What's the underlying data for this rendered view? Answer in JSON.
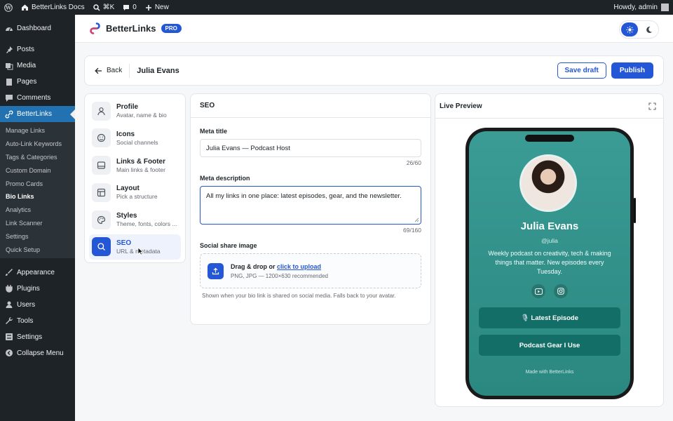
{
  "adminbar": {
    "site_name": "BetterLinks Docs",
    "shortcut": "⌘K",
    "comments_count": "0",
    "new_label": "New",
    "howdy": "Howdy, admin"
  },
  "sidebar": {
    "dashboard": "Dashboard",
    "posts": "Posts",
    "media": "Media",
    "pages": "Pages",
    "comments": "Comments",
    "betterlinks": "BetterLinks",
    "submenu": [
      "Manage Links",
      "Auto-Link Keywords",
      "Tags & Categories",
      "Custom Domain",
      "Promo Cards",
      "Bio Links",
      "Analytics",
      "Link Scanner",
      "Settings",
      "Quick Setup"
    ],
    "appearance": "Appearance",
    "plugins": "Plugins",
    "users": "Users",
    "tools": "Tools",
    "settings": "Settings",
    "collapse": "Collapse Menu"
  },
  "header": {
    "brand": "BetterLinks",
    "badge": "PRO"
  },
  "page": {
    "back_label": "Back",
    "title": "Julia Evans",
    "save_draft": "Save draft",
    "publish": "Publish"
  },
  "nav": [
    {
      "title": "Profile",
      "sub": "Avatar, name & bio"
    },
    {
      "title": "Icons",
      "sub": "Social channels"
    },
    {
      "title": "Links & Footer",
      "sub": "Main links & footer"
    },
    {
      "title": "Layout",
      "sub": "Pick a structure"
    },
    {
      "title": "Styles",
      "sub": "Theme, fonts, colors ..."
    },
    {
      "title": "SEO",
      "sub": "URL & metadata"
    }
  ],
  "seo": {
    "heading": "SEO",
    "meta_title_label": "Meta title",
    "meta_title_value": "Julia Evans — Podcast Host",
    "meta_title_count": "26/60",
    "meta_desc_label": "Meta description",
    "meta_desc_value": "All my links in one place: latest episodes, gear, and the newsletter.",
    "meta_desc_count": "69/160",
    "share_label": "Social share image",
    "upload_main": "Drag & drop or ",
    "upload_link": "click to upload",
    "upload_sub": "PNG, JPG — 1200×630 recommended",
    "hint": "Shown when your bio link is shared on social media. Falls back to your avatar."
  },
  "preview": {
    "heading": "Live Preview",
    "name": "Julia Evans",
    "handle": "@julia",
    "bio": "Weekly podcast on creativity, tech & making things that matter. New episodes every Tuesday.",
    "link1": "🎙️ Latest Episode",
    "link2": "Podcast Gear I Use",
    "footer": "Made with BetterLinks"
  },
  "colors": {
    "accent": "#2457d6",
    "wp_active": "#2271b1",
    "preview_bg": "#2f918a",
    "preview_button": "#126e66"
  }
}
